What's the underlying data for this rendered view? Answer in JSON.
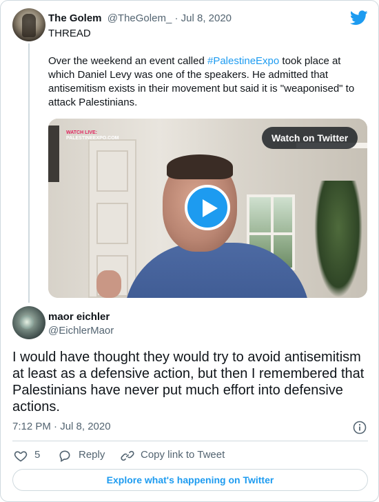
{
  "parent": {
    "name": "The Golem",
    "handle": "@TheGolem_",
    "separator": " · ",
    "date": "Jul 8, 2020",
    "thread_label": "THREAD",
    "text_before": "Over the weekend an event called ",
    "hashtag": "#PalestineExpo",
    "text_after": " took place at which Daniel Levy was one of the speakers. He admitted that antisemitism exists in their movement but said it is \"weaponised\" to attack Palestinians."
  },
  "video": {
    "watch_label": "Watch on Twitter",
    "watermark_live": "WATCH LIVE:",
    "watermark_site": "PALESTINEEXPO.COM"
  },
  "reply": {
    "name": "maor eichler",
    "handle": "@EichlerMaor",
    "text": "I would have thought they would try to avoid antisemitism at least as a defensive action, but then I remembered that Palestinians have never put much effort into defensive actions.",
    "time": "7:12 PM · Jul 8, 2020"
  },
  "actions": {
    "like_count": "5",
    "reply_label": "Reply",
    "copy_label": "Copy link to Tweet"
  },
  "footer": {
    "explore_label": "Explore what's happening on Twitter"
  },
  "colors": {
    "accent": "#1d9bf0",
    "text": "#0f1419",
    "muted": "#536471",
    "border": "#cfd9de"
  },
  "icons": [
    "twitter-bird-icon",
    "play-icon",
    "info-icon",
    "heart-icon",
    "reply-bubble-icon",
    "link-icon"
  ]
}
